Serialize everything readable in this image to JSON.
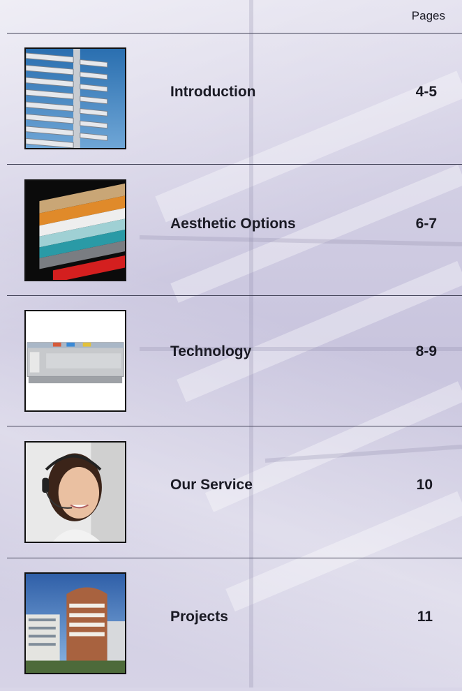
{
  "header": {
    "pages_label": "Pages"
  },
  "toc": [
    {
      "title": "Introduction",
      "pages": "4-5",
      "image": "louvre-blinds-photo"
    },
    {
      "title": "Aesthetic Options",
      "pages": "6-7",
      "image": "layered-material-samples-photo"
    },
    {
      "title": "Technology",
      "pages": "8-9",
      "image": "control-module-photo"
    },
    {
      "title": "Our Service",
      "pages": "10",
      "image": "headset-operator-photo"
    },
    {
      "title": "Projects",
      "pages": "11",
      "image": "office-building-photo"
    }
  ]
}
